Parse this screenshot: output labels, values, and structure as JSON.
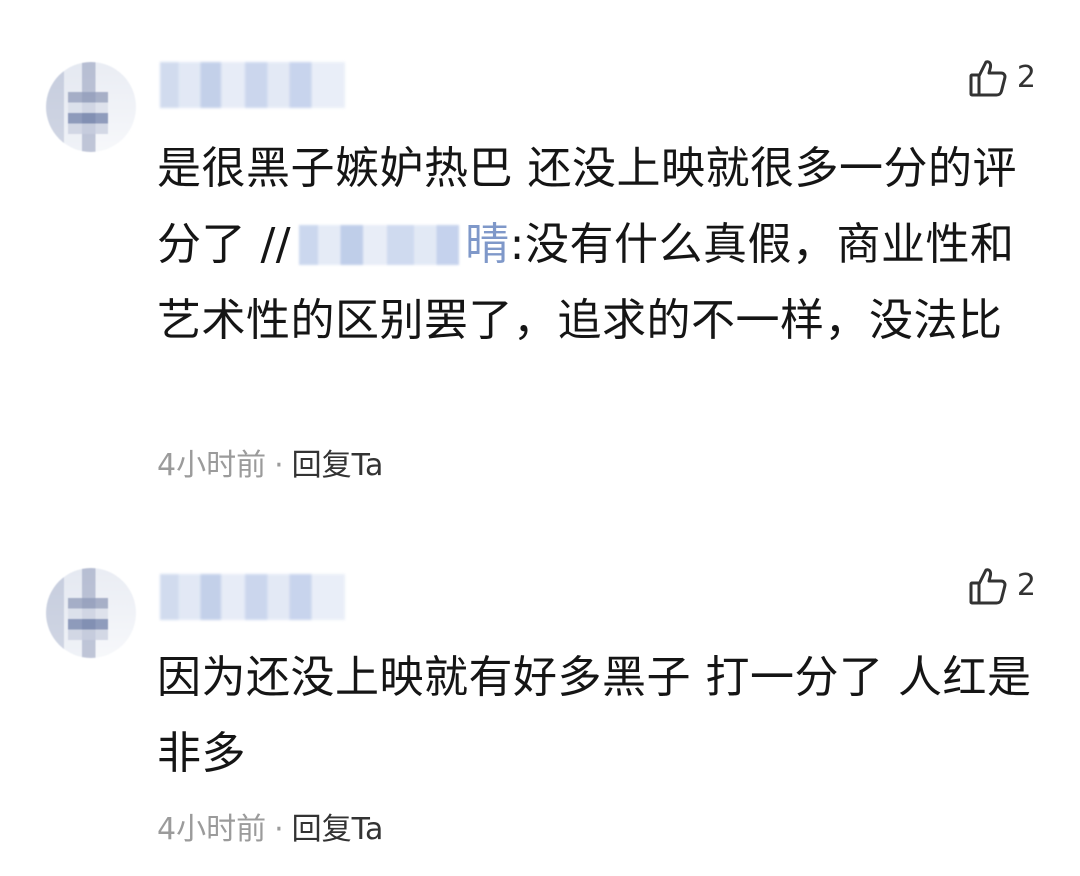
{
  "comments": [
    {
      "likes": "2",
      "text_before_mention": "是很黑子嫉妒热巴 还没上映就很多一分的评分了 //",
      "mention_tail": "晴",
      "text_after_mention": ":没有什么真假，商业性和艺术性的区别罢了，追求的不一样，没法比",
      "time": "4小时前",
      "separator": "·",
      "reply_label": "回复Ta"
    },
    {
      "likes": "2",
      "text": "因为还没上映就有好多黑子 打一分了 人红是非多",
      "time": "4小时前",
      "separator": "·",
      "reply_label": "回复Ta"
    }
  ],
  "icons": {
    "like": "thumbs-up-icon"
  },
  "colors": {
    "text": "#151515",
    "meta": "#9b9b9b",
    "reply": "#333333",
    "mention": "#7f98c9"
  }
}
